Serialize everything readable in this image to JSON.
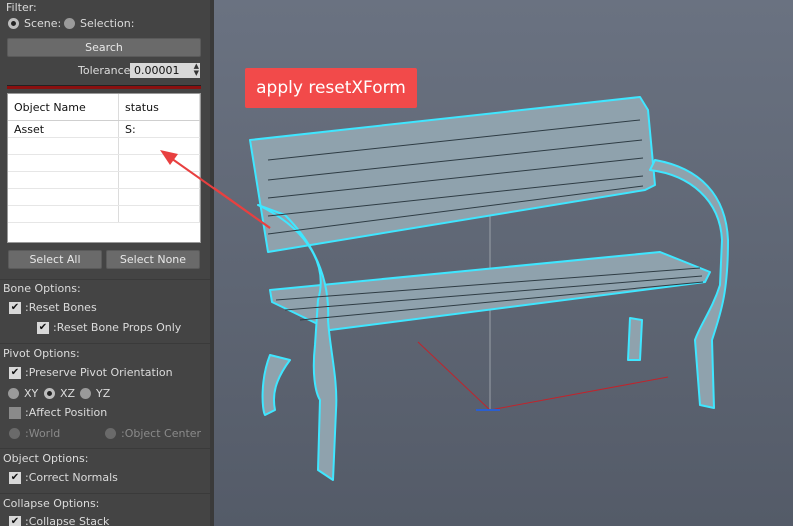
{
  "filter": {
    "title": "Filter:",
    "scene_label": "Scene:",
    "selection_label": "Selection:",
    "search_label": "Search",
    "tolerance_label": "Tolerance:",
    "tolerance_value": "0.00001"
  },
  "object_list": {
    "columns": [
      "Object Name",
      "status"
    ],
    "rows": [
      {
        "name": "Asset",
        "status": "S:"
      }
    ],
    "select_all_label": "Select All",
    "select_none_label": "Select None"
  },
  "bone_options": {
    "title": "Bone Options:",
    "reset_bones_label": ":Reset Bones",
    "reset_bones_checked": true,
    "reset_bone_props_label": ":Reset Bone Props Only",
    "reset_bone_props_checked": true
  },
  "pivot_options": {
    "title": "Pivot Options:",
    "preserve_label": ":Preserve Pivot Orientation",
    "preserve_checked": true,
    "axis_options": [
      "XY",
      "XZ",
      "YZ"
    ],
    "axis_selected": "XZ",
    "affect_position_label": ":Affect Position",
    "affect_position_checked": false,
    "world_label": ":World",
    "object_center_label": ":Object Center"
  },
  "object_options": {
    "title": "Object Options:",
    "correct_normals_label": ":Correct Normals",
    "correct_normals_checked": true
  },
  "collapse_options": {
    "title": "Collapse Options:",
    "collapse_stack_label": ":Collapse Stack",
    "collapse_stack_checked": true
  },
  "annotation": {
    "text": "apply resetXForm",
    "color": "#f24a4a"
  },
  "colors": {
    "panel_bg": "#444444",
    "viewport_bg": "#5f6775",
    "selection_outline": "#3fe6ff",
    "bench_fill": "#8fa2ad"
  }
}
